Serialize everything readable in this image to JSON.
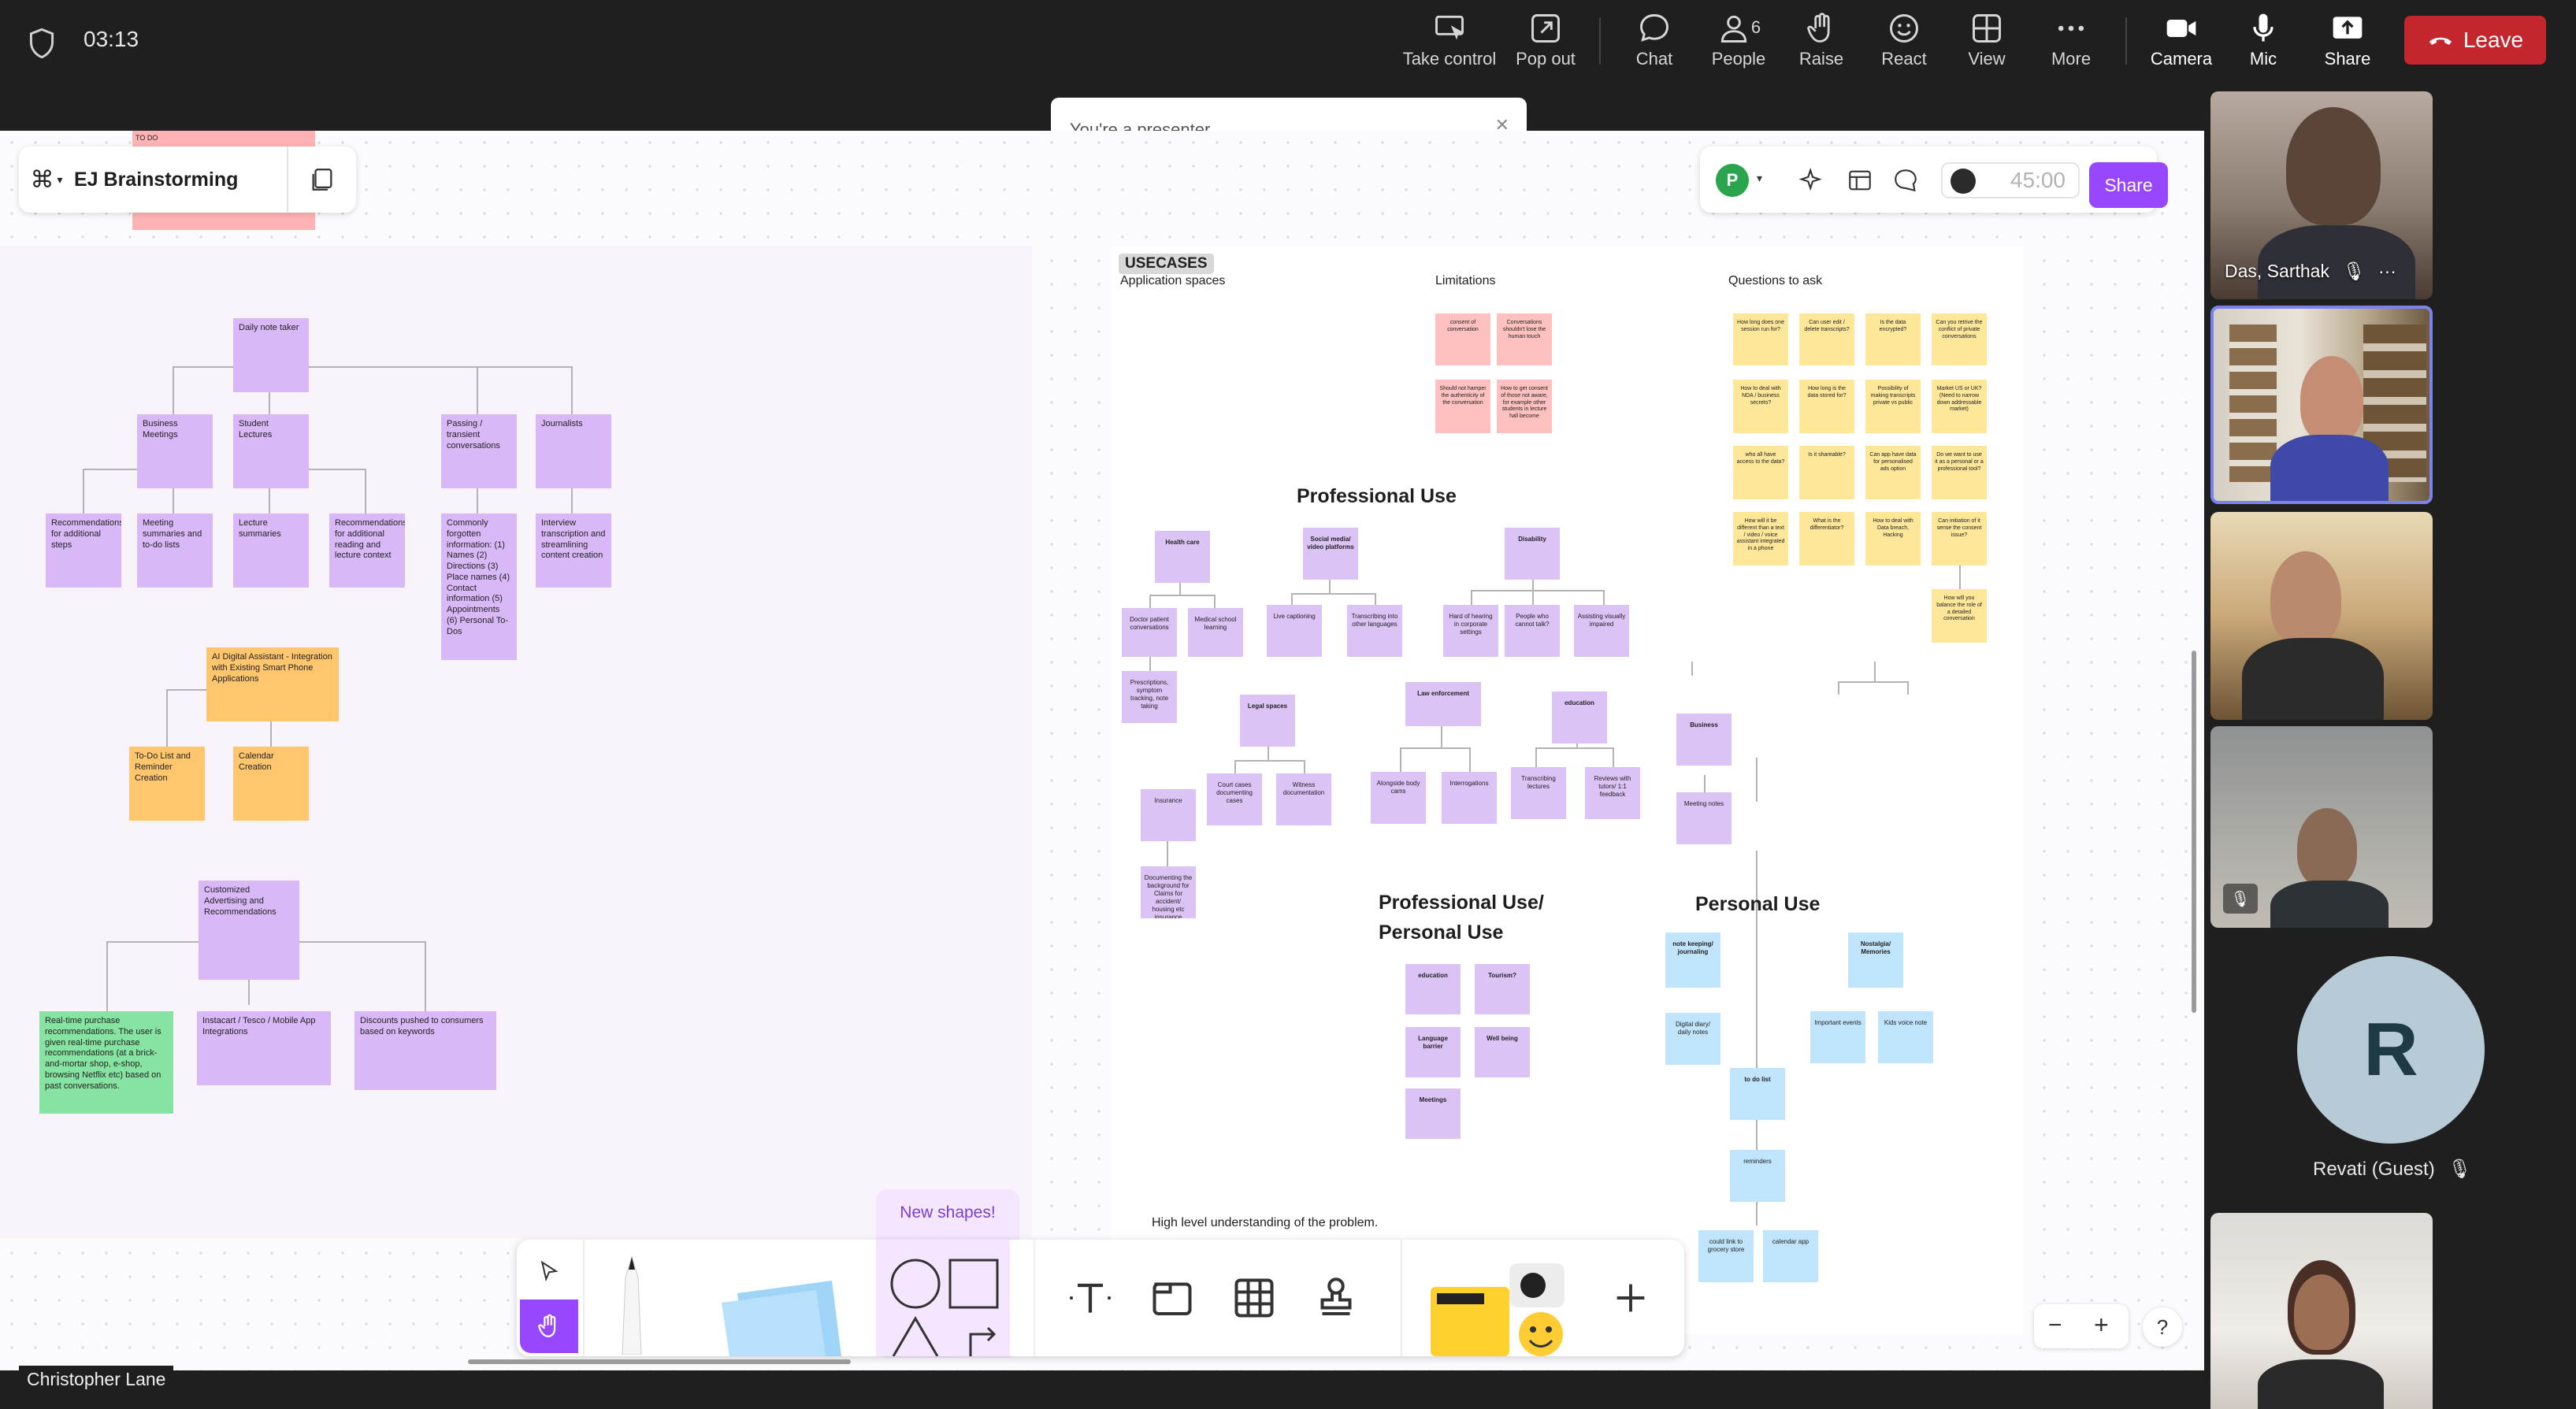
{
  "meeting": {
    "elapsed_time": "03:13",
    "controls": [
      {
        "label": "Take control",
        "icon": "take-control-icon"
      },
      {
        "label": "Pop out",
        "icon": "pop-out-icon"
      },
      {
        "label": "Chat",
        "icon": "chat-icon"
      },
      {
        "label": "People",
        "icon": "people-icon",
        "count": "6"
      },
      {
        "label": "Raise",
        "icon": "raise-hand-icon"
      },
      {
        "label": "React",
        "icon": "react-icon"
      },
      {
        "label": "View",
        "icon": "view-icon"
      },
      {
        "label": "More",
        "icon": "more-icon"
      },
      {
        "label": "Camera",
        "icon": "camera-icon"
      },
      {
        "label": "Mic",
        "icon": "mic-icon"
      },
      {
        "label": "Share",
        "icon": "share-icon"
      }
    ],
    "leave_label": "Leave",
    "presenter_tip": "You're a presenter",
    "presenter_name": "Christopher Lane",
    "participants": [
      {
        "name": "Das, Sarthak"
      },
      {
        "name": ""
      },
      {
        "name": ""
      },
      {
        "name": ""
      },
      {
        "name": "Revati (Guest)",
        "initial": "R"
      },
      {
        "name": ""
      }
    ],
    "colors": {
      "leave": "#c4262e",
      "active_tile_border": "#7b83eb"
    }
  },
  "figjam": {
    "file_title": "EJ Brainstorming",
    "avatar_initial": "P",
    "timer": "45:00",
    "share_label": "Share",
    "new_shapes_label": "New shapes!",
    "accent": "#9747ff",
    "partial_sticky": "TO DO"
  },
  "board_left": {
    "root": "Daily note taker",
    "level1": [
      "Business Meetings",
      "Student Lectures",
      "Passing / transient conversations",
      "Journalists"
    ],
    "level2": [
      "Recommendations for additional steps",
      "Meeting summaries and to-do lists",
      "Lecture summaries",
      "Recommendations for additional reading and lecture context",
      "Commonly forgotten information: (1) Names (2) Directions (3) Place names (4) Contact information (5) Appointments (6) Personal To-Dos",
      "Interview transcription and streamlining content creation"
    ],
    "assistant": "AI Digital Assistant - Integration with Existing Smart Phone Applications",
    "assistant_children": [
      "To-Do List and Reminder Creation",
      "Calendar Creation"
    ],
    "ads": "Customized Advertising and Recommendations",
    "ads_children": [
      "Real-time purchase recommendations. The user is given real-time purchase recommendations (at a brick-and-mortar shop, e-shop, browsing Netflix etc) based on past conversations.",
      "Instacart / Tesco / Mobile App Integrations",
      "Discounts pushed to consumers based on keywords"
    ]
  },
  "board_right": {
    "usecases_label": "USECASES",
    "application_spaces": "Application spaces",
    "limitations_label": "Limitations",
    "questions_label": "Questions to ask",
    "limitations": [
      "consent of conversation",
      "Conversations shouldn't lose the human touch",
      "Should not hamper the authenticity of the conversation",
      "How to get consent of those not aware, for example other students in lecture hall become"
    ],
    "questions": [
      "How long does one session run for?",
      "Can user edit / delete transcripts?",
      "Is the data encrypted?",
      "Can you retrive the conflict of private conversations",
      "How to deal with NDA / business secrets?",
      "How long is the data stored for?",
      "Possibility of making transcripts private vs public",
      "Market US or UK? (Need to narrow down addressable market)",
      "who all have access to the data?",
      "Is it shareable?",
      "Can app have data for personalised ads option",
      "Do we want to use it as a personal or a professional tool?",
      "How will it be different than a text / video / voice assistant integrated in a phone",
      "What is the differentiator?",
      "How to deal with Data breach, Hacking",
      "Can initiation of it sense the consent issue?",
      "How will you balance the role of a detailed conversation"
    ],
    "professional_use": "Professional Use",
    "healthcare": "Health care",
    "healthcare_children": [
      "Doctor patient conversations",
      "Medical school learning",
      "Prescriptions, symptom tracking, note taking"
    ],
    "social": "Social media/ video platforms",
    "social_children": [
      "Live captioning",
      "Transcribing into other languages"
    ],
    "disability": "Disability",
    "disability_children": [
      "Hard of hearing in corporate settings",
      "People who cannot talk?",
      "Assisting visually impaired"
    ],
    "legal": "Legal spaces",
    "legal_children": [
      "Insurance",
      "Court cases documenting cases",
      "Witness documentation",
      "Documenting the background for Claims for accident/ housing etc insurance"
    ],
    "law": "Law enforcement",
    "law_children": [
      "Alongside body cams",
      "Interrogations"
    ],
    "education": "education",
    "education_children": [
      "Transcribing lectures",
      "Reviews with tutors/ 1:1 feedback"
    ],
    "business": "Business",
    "business_children": [
      "Meeting notes"
    ],
    "prof_personal": "Professional Use/ Personal Use",
    "prof_personal_items": [
      "education",
      "Tourism?",
      "Language barrier",
      "Well being",
      "Meetings"
    ],
    "personal_use": "Personal Use",
    "note_keeping": "note keeping/ journaling",
    "note_keeping_children": [
      "Digital diary/ daily notes"
    ],
    "nostalgia": "Nostalgia/ Memories",
    "nostalgia_children": [
      "Important events",
      "Kids voice note"
    ],
    "todo": "to do list",
    "todo_children": [
      "reminders",
      "could link to grocery store",
      "calendar app"
    ],
    "footer_note": "High level understanding of the problem."
  }
}
